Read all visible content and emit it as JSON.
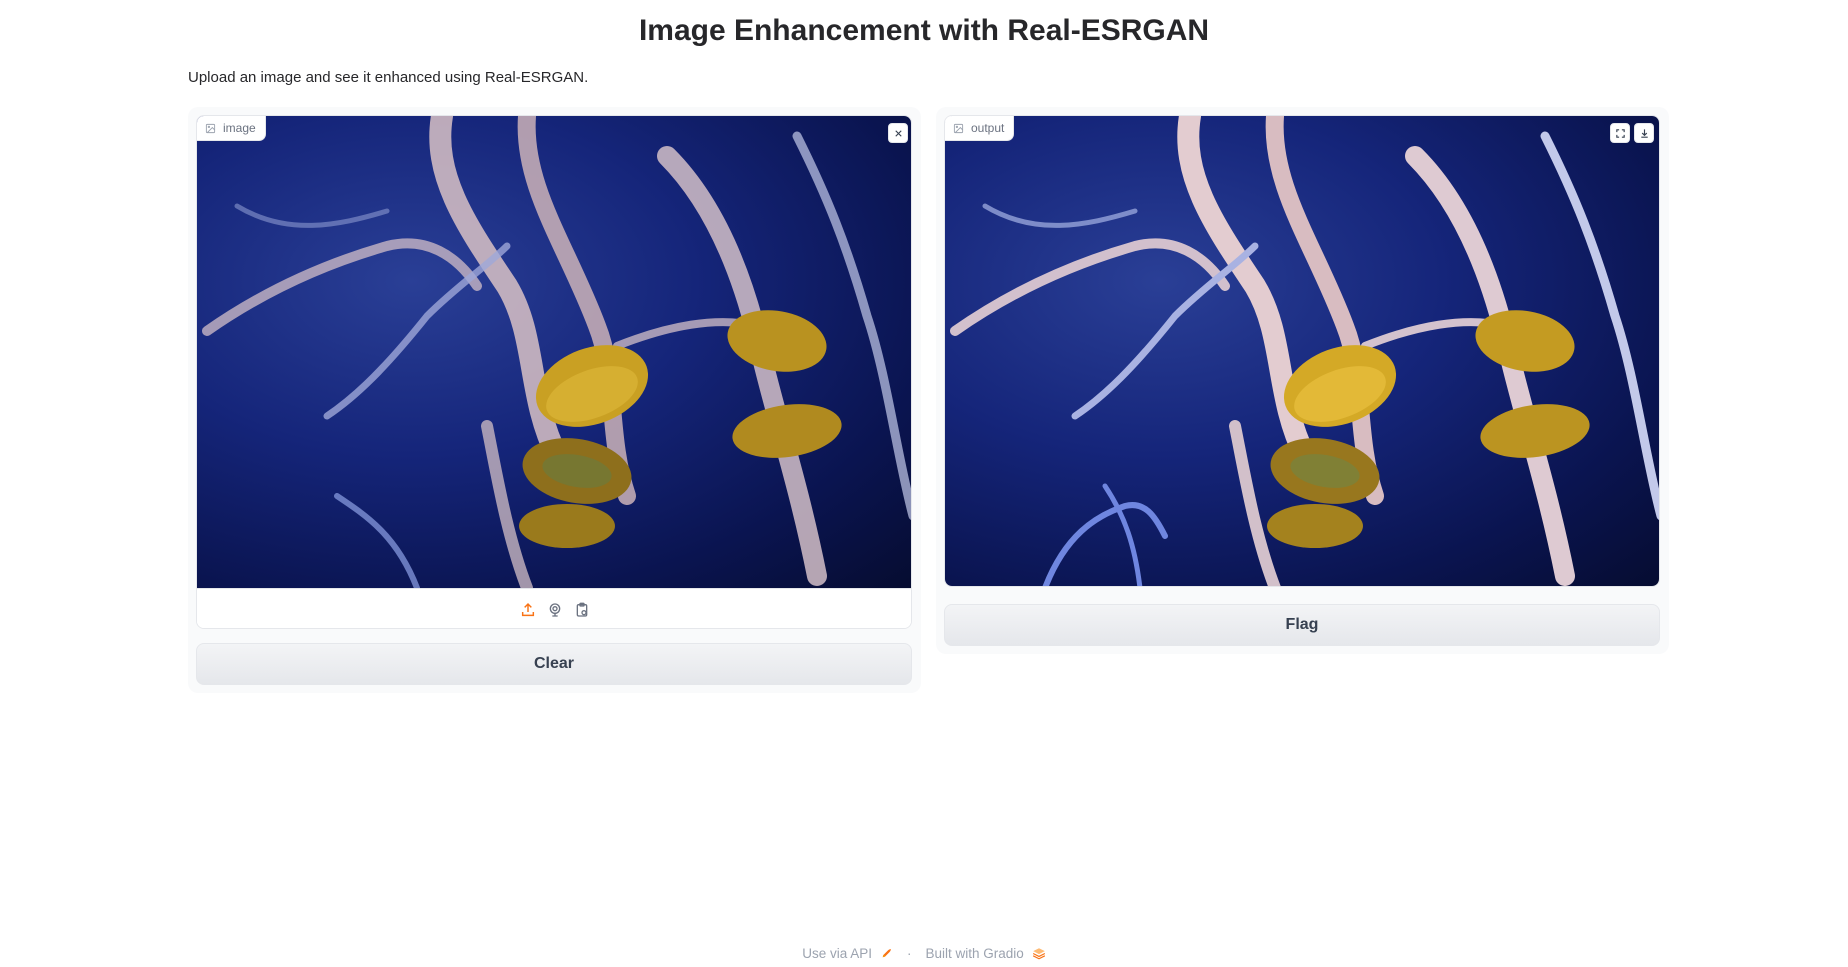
{
  "header": {
    "title": "Image Enhancement with Real-ESRGAN",
    "description": "Upload an image and see it enhanced using Real-ESRGAN."
  },
  "input_panel": {
    "label": "image",
    "clear_label": "Clear",
    "sources": [
      "upload-icon",
      "webcam-icon",
      "clipboard-icon"
    ]
  },
  "output_panel": {
    "label": "output",
    "flag_label": "Flag"
  },
  "footer": {
    "api_label": "Use via API",
    "separator": "·",
    "built_label": "Built with Gradio"
  },
  "colors": {
    "accent": "#f97316",
    "water": "#15257a",
    "jelly_bell": "#c9a023",
    "tentacle": "#d8c3c8"
  }
}
